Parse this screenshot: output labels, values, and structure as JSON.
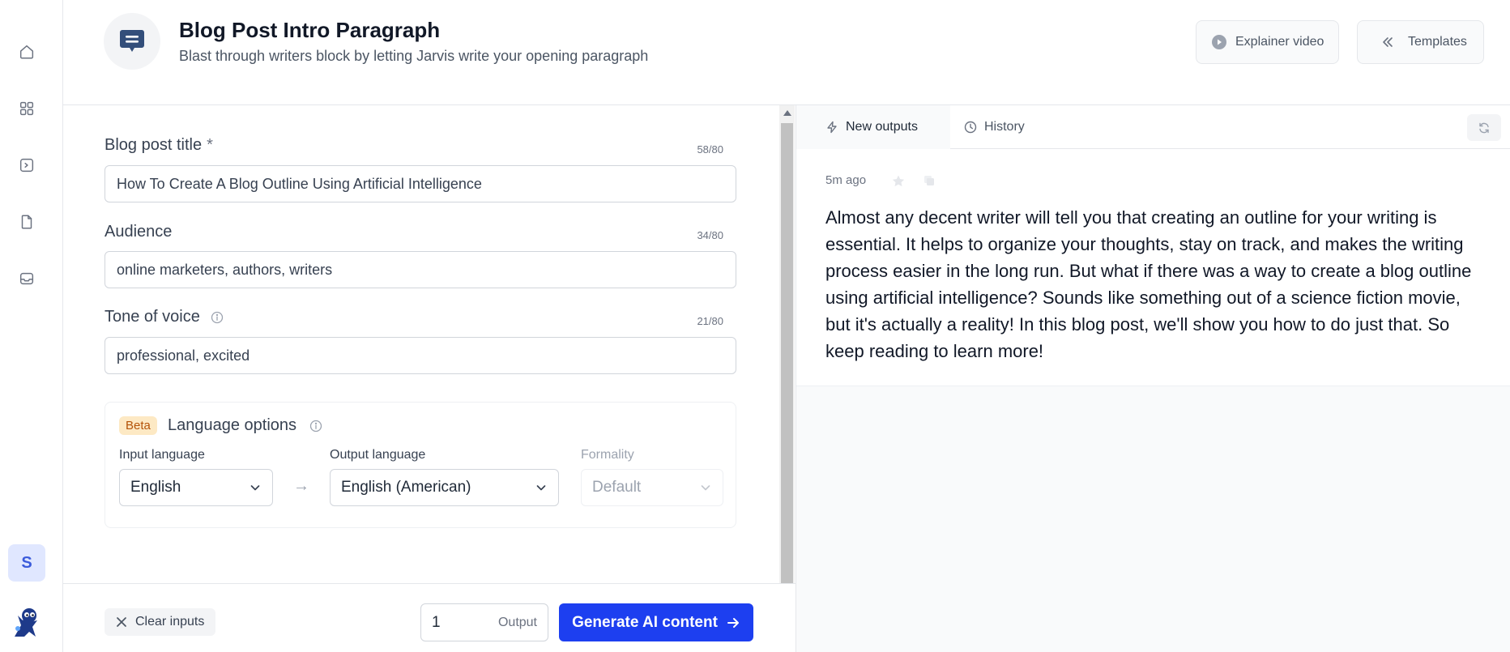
{
  "header": {
    "title": "Blog Post Intro Paragraph",
    "subtitle": "Blast through writers block by letting Jarvis write your opening paragraph",
    "explainer_label": "Explainer video",
    "templates_label": "Templates"
  },
  "sidebar": {
    "avatar_initial": "S",
    "icons": [
      "home-icon",
      "grid-icon",
      "terminal-icon",
      "document-icon",
      "inbox-icon"
    ]
  },
  "form": {
    "title_field": {
      "label": "Blog post title",
      "required_mark": "*",
      "counter": "58/80",
      "value": "How To Create A Blog Outline Using Artificial Intelligence"
    },
    "audience_field": {
      "label": "Audience",
      "counter": "34/80",
      "value": "online marketers, authors, writers"
    },
    "tone_field": {
      "label": "Tone of voice",
      "counter": "21/80",
      "value": "professional, excited"
    },
    "language": {
      "badge": "Beta",
      "title": "Language options",
      "input_label": "Input language",
      "input_value": "English",
      "output_label": "Output language",
      "output_value": "English (American)",
      "formality_label": "Formality",
      "formality_value": "Default",
      "separator": "→"
    }
  },
  "footer": {
    "clear_label": "Clear inputs",
    "output_count": "1",
    "output_label": "Output",
    "generate_label": "Generate AI content"
  },
  "outputs": {
    "tab_new": "New outputs",
    "tab_history": "History",
    "items": [
      {
        "time": "5m ago",
        "text": "Almost any decent writer will tell you that creating an outline for your writing is essential. It helps to organize your thoughts, stay on track, and makes the writing process easier in the long run. But what if there was a way to create a blog outline using artificial intelligence? Sounds like something out of a science fiction movie, but it's actually a reality! In this blog post, we'll show you how to do just that. So keep reading to learn more!"
      }
    ]
  },
  "colors": {
    "primary": "#1d3ff0",
    "beta_bg": "#fde9c4",
    "beta_text": "#b45309",
    "avatar_bg": "#e0e7ff"
  }
}
